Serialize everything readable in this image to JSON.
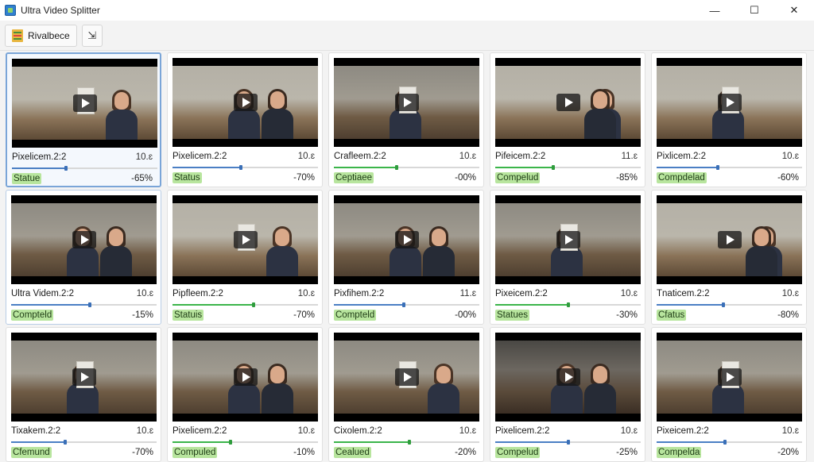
{
  "window": {
    "title": "Ultra Video Splitter",
    "controls": {
      "minimize": "—",
      "maximize": "☐",
      "close": "✕"
    }
  },
  "toolbar": {
    "main_button_label": "Rivalbece",
    "secondary_icon": "⇲"
  },
  "cards": [
    {
      "name": "Pixelicem.2:2",
      "duration": "10.ɛ",
      "progress": 0.37,
      "status": "Statue",
      "percent": "-65%",
      "selected": true,
      "bar": "blue"
    },
    {
      "name": "Pixelicem.2:2",
      "duration": "10.ɛ",
      "progress": 0.47,
      "status": "Status",
      "percent": "-70%",
      "bar": "blue"
    },
    {
      "name": "Crafleem.2:2",
      "duration": "10.ɛ",
      "progress": 0.43,
      "status": "Ceptiaee",
      "percent": "-00%",
      "bar": "green"
    },
    {
      "name": "Pifeicem.2:2",
      "duration": "11.ɛ",
      "progress": 0.4,
      "status": "Compelud",
      "percent": "-85%",
      "bar": "green"
    },
    {
      "name": "Pixlicem.2:2",
      "duration": "10.ɛ",
      "progress": 0.42,
      "status": "Compdelad",
      "percent": "-60%",
      "bar": "blue"
    },
    {
      "name": "Ultra Videm.2:2",
      "duration": "10.ɛ",
      "progress": 0.54,
      "status": "Compteld",
      "percent": "-15%",
      "hover": true,
      "bar": "blue"
    },
    {
      "name": "Pipfleem.2:2",
      "duration": "10.ɛ",
      "progress": 0.56,
      "status": "Statuis",
      "percent": "-70%",
      "bar": "green"
    },
    {
      "name": "Pixfihem.2:2",
      "duration": "11.ɛ",
      "progress": 0.48,
      "status": "Compteld",
      "percent": "-00%",
      "bar": "blue"
    },
    {
      "name": "Pixeicem.2:2",
      "duration": "10.ɛ",
      "progress": 0.5,
      "status": "Statues",
      "percent": "-30%",
      "bar": "green"
    },
    {
      "name": "Tnaticem.2:2",
      "duration": "10.ɛ",
      "progress": 0.46,
      "status": "Cfatus",
      "percent": "-80%",
      "bar": "blue"
    },
    {
      "name": "Tixakem.2:2",
      "duration": "10.ɛ",
      "progress": 0.37,
      "status": "Cfemund",
      "percent": "-70%",
      "bar": "blue"
    },
    {
      "name": "Pixelicem.2:2",
      "duration": "10.ɛ",
      "progress": 0.4,
      "status": "Compuled",
      "percent": "-10%",
      "bar": "green"
    },
    {
      "name": "Cixolem.2:2",
      "duration": "10.ɛ",
      "progress": 0.52,
      "status": "Cealued",
      "percent": "-20%",
      "bar": "green"
    },
    {
      "name": "Pixelicem.2:2",
      "duration": "10.ɛ",
      "progress": 0.5,
      "status": "Compelud",
      "percent": "-25%",
      "bar": "blue"
    },
    {
      "name": "Pixeicem.2:2",
      "duration": "10.ɛ",
      "progress": 0.47,
      "status": "Compelda",
      "percent": "-20%",
      "bar": "blue"
    }
  ],
  "colors": {
    "accent": "#4b7fc4",
    "status_badge": "#b8e59e",
    "selected_border": "#7aa5d8"
  }
}
